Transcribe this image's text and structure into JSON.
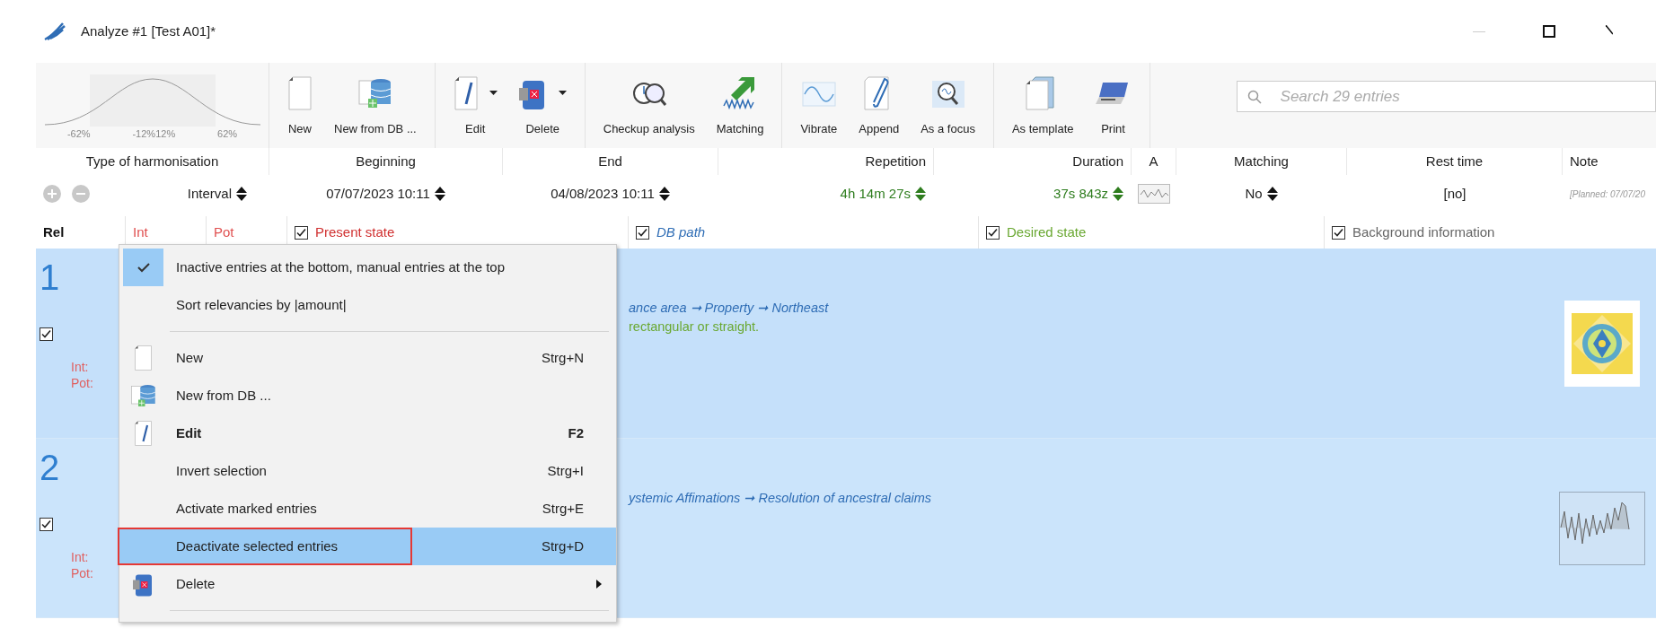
{
  "window": {
    "title": "Analyze #1 [Test A01]*"
  },
  "toolbar": {
    "curve_labels": [
      "-62%",
      "-12%",
      "12%",
      "62%"
    ],
    "groups": [
      [
        {
          "label": "New",
          "caret": false
        },
        {
          "label": "New from DB ...",
          "caret": false
        }
      ],
      [
        {
          "label": "Edit",
          "caret": true
        },
        {
          "label": "Delete",
          "caret": true
        }
      ],
      [
        {
          "label": "Checkup analysis",
          "caret": false
        },
        {
          "label": "Matching",
          "caret": false
        }
      ],
      [
        {
          "label": "Vibrate",
          "caret": false
        },
        {
          "label": "Append",
          "caret": false
        },
        {
          "label": "As a focus",
          "caret": false
        }
      ],
      [
        {
          "label": "As template",
          "caret": false
        },
        {
          "label": "Print",
          "caret": false
        }
      ]
    ],
    "search": {
      "placeholder": "Search 29 entries"
    }
  },
  "settings": {
    "columns": [
      {
        "label": "Type of harmonisation",
        "value": "Interval",
        "kind": "spin",
        "color": "#222222"
      },
      {
        "label": "Beginning",
        "value": "07/07/2023 10:11",
        "kind": "spin",
        "color": "#222222"
      },
      {
        "label": "End",
        "value": "04/08/2023 10:11",
        "kind": "spin",
        "color": "#222222"
      },
      {
        "label": "Repetition",
        "value": "4h 14m 27s",
        "kind": "spin",
        "color": "#2e7d1e"
      },
      {
        "label": "Duration",
        "value": "37s 843z",
        "kind": "spin",
        "color": "#2e7d1e"
      },
      {
        "label": "A",
        "kind": "wave"
      },
      {
        "label": "Matching",
        "value": "No",
        "kind": "spin",
        "color": "#222222"
      },
      {
        "label": "Rest time",
        "value": "[no]",
        "kind": "plain",
        "color": "#222222"
      },
      {
        "label": "Note",
        "value": "[Planned: 07/07/20",
        "kind": "note",
        "color": "#999999"
      }
    ]
  },
  "grid": {
    "columns": [
      {
        "label": "Rel",
        "checkbox": false,
        "color": "#111111",
        "italic": false
      },
      {
        "label": "Int",
        "checkbox": false,
        "color": "#e05050",
        "italic": false
      },
      {
        "label": "Pot",
        "checkbox": false,
        "color": "#e05050",
        "italic": false
      },
      {
        "label": "Present state",
        "checkbox": true,
        "checked": true,
        "color": "#d03030",
        "italic": false
      },
      {
        "label": "DB path",
        "checkbox": true,
        "checked": true,
        "color": "#2f6db5",
        "italic": true
      },
      {
        "label": "Desired state",
        "checkbox": true,
        "checked": true,
        "color": "#6aa832",
        "italic": false
      },
      {
        "label": "Background information",
        "checkbox": true,
        "checked": true,
        "color": "#666666",
        "italic": false
      }
    ],
    "rows": [
      {
        "number": "1",
        "checked": true,
        "int_label": "Int:",
        "pot_label": "Pot:",
        "db_path": "ance area ➞ Property ➞ Northeast",
        "desired": "rectangular or straight."
      },
      {
        "number": "2",
        "checked": true,
        "int_label": "Int:",
        "pot_label": "Pot:",
        "db_path": "ystemic Affimations ➞ Resolution of ancestral claims"
      }
    ]
  },
  "context_menu": {
    "items": [
      {
        "kind": "check",
        "label": "Inactive entries at the bottom, manual entries at the top",
        "checked": true
      },
      {
        "kind": "check",
        "label": "Sort relevancies by |amount|",
        "checked": false
      },
      {
        "kind": "separator"
      },
      {
        "kind": "item",
        "label": "New",
        "shortcut": "Strg+N",
        "bold": false,
        "selected": false,
        "submenu": false,
        "outlined": false
      },
      {
        "kind": "item",
        "label": "New from DB ...",
        "bold": false,
        "selected": false,
        "submenu": false,
        "outlined": false
      },
      {
        "kind": "item",
        "label": "Edit",
        "shortcut": "F2",
        "bold": true,
        "selected": false,
        "submenu": false,
        "outlined": false
      },
      {
        "kind": "item",
        "label": "Invert selection",
        "shortcut": "Strg+I",
        "bold": false,
        "selected": false,
        "submenu": false,
        "outlined": false
      },
      {
        "kind": "item",
        "label": "Activate marked entries",
        "shortcut": "Strg+E",
        "bold": false,
        "selected": false,
        "submenu": false,
        "outlined": false
      },
      {
        "kind": "item",
        "label": "Deactivate selected entries",
        "shortcut": "Strg+D",
        "bold": false,
        "selected": true,
        "submenu": false,
        "outlined": true
      },
      {
        "kind": "item",
        "label": "Delete",
        "bold": false,
        "selected": false,
        "submenu": true,
        "outlined": false
      },
      {
        "kind": "separator"
      }
    ]
  }
}
